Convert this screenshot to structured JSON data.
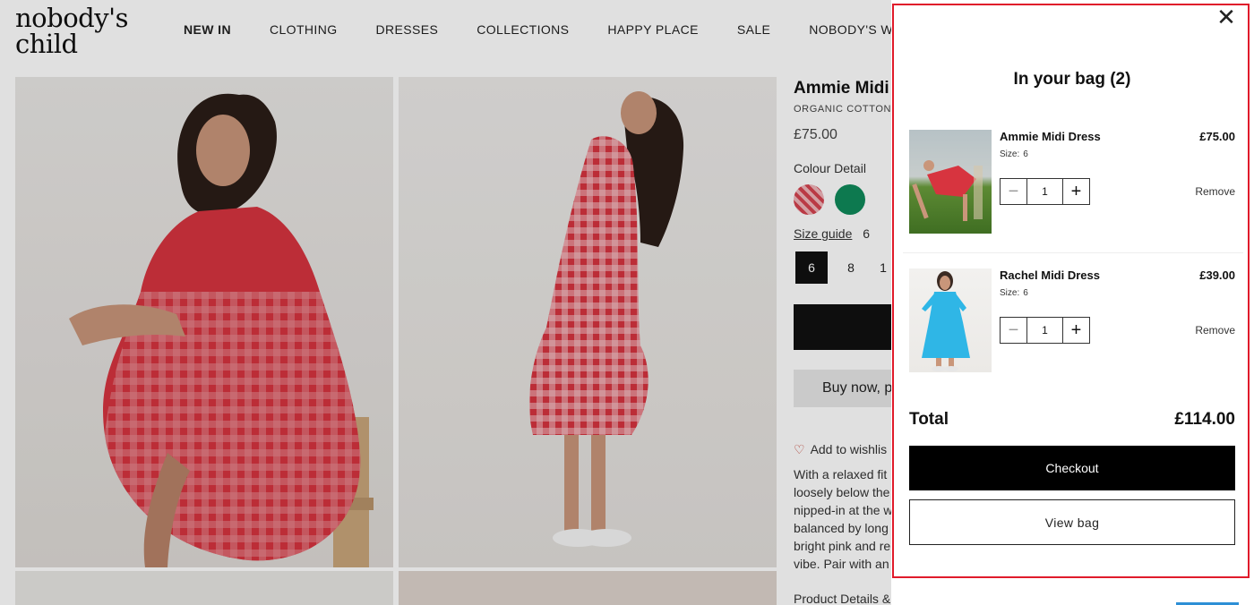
{
  "brand": {
    "logo_line1": "nobody's",
    "logo_line2": "child"
  },
  "nav": [
    "NEW IN",
    "CLOTHING",
    "DRESSES",
    "COLLECTIONS",
    "HAPPY PLACE",
    "SALE",
    "NOBODY'S WORLD"
  ],
  "product": {
    "title": "Ammie Midi",
    "subtitle": "ORGANIC COTTON",
    "price": "£75.00",
    "colour_label": "Colour Detail",
    "size_guide_label": "Size guide",
    "size_guide_value": "6",
    "sizes": [
      "6",
      "8",
      "1"
    ],
    "buy_now_label": "Buy now, p",
    "wishlist_label": "Add to wishlis",
    "description_lines": [
      "With a relaxed fit",
      "loosely below the",
      "nipped-in at the w",
      "balanced by long",
      "bright pink and re",
      "vibe. Pair with an"
    ],
    "details_label": "Product Details &"
  },
  "bag": {
    "title": "In your bag (2)",
    "close_symbol": "✕",
    "items": [
      {
        "name": "Ammie Midi Dress",
        "size_label": "Size:",
        "size": "6",
        "price": "£75.00",
        "qty": "1",
        "remove_label": "Remove",
        "minus": "−",
        "plus": "+"
      },
      {
        "name": "Rachel Midi Dress",
        "size_label": "Size:",
        "size": "6",
        "price": "£39.00",
        "qty": "1",
        "remove_label": "Remove",
        "minus": "−",
        "plus": "+"
      }
    ],
    "total_label": "Total",
    "total_value": "£114.00",
    "checkout_label": "Checkout",
    "view_bag_label": "View bag"
  },
  "colors": {
    "highlight": "#e01b2b",
    "dress_red": "#d7343f",
    "dress_blue": "#2fb6e6",
    "swatch_green": "#0f8a5a"
  }
}
